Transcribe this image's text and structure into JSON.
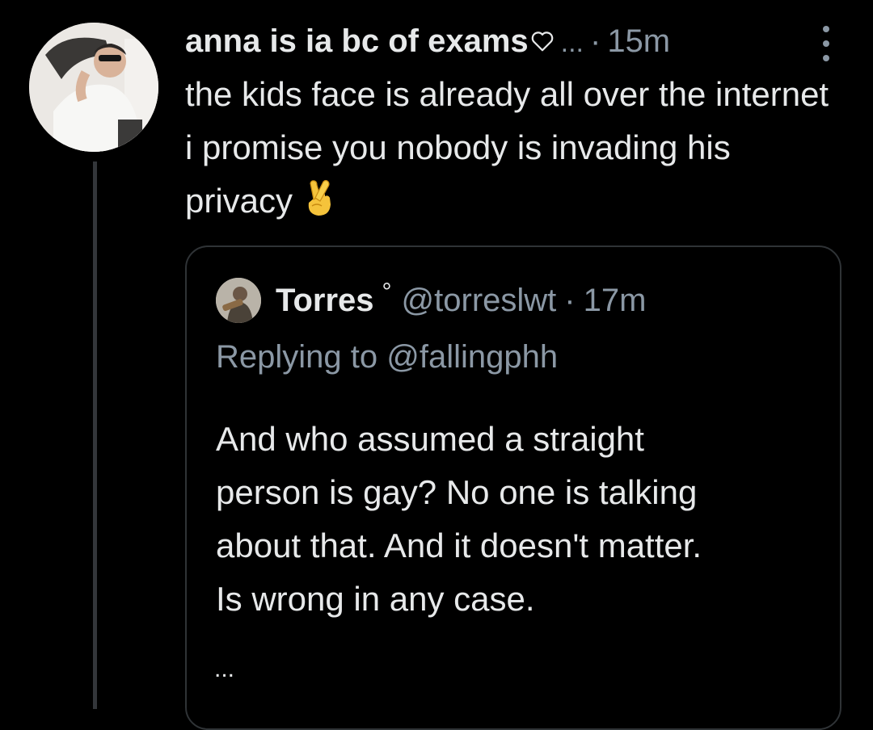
{
  "tweet": {
    "display_name": "anna is ia bc of exams",
    "truncation": "...",
    "separator": "·",
    "time": "15m",
    "text": "the kids face is already all over the internet i promise you nobody is invading his privacy",
    "emoji": "crossed-fingers-icon"
  },
  "quoted_tweet": {
    "display_name": "Torres",
    "badge": "°",
    "handle": "@torreslwt",
    "separator": "·",
    "time": "17m",
    "reply_context": "Replying to @fallingphh",
    "text_lines": [
      "And who assumed a straight",
      "person is gay? No one is talking",
      "about that. And it doesn't matter.",
      "Is wrong in any case."
    ],
    "more": "..."
  },
  "colors": {
    "background": "#000000",
    "primary_text": "#e7e9ea",
    "secondary_text": "#8b98a5",
    "border": "#2f3336",
    "thread_line": "#33363a"
  }
}
